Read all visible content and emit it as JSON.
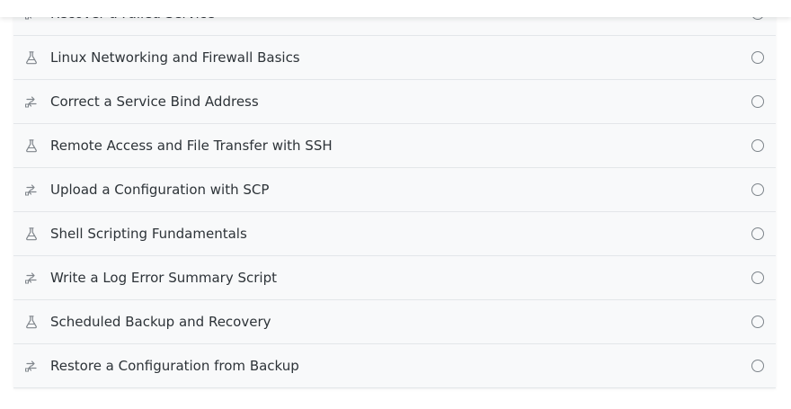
{
  "items": [
    {
      "label": "Recover a Failed Service",
      "icon": "lab-swap-icon"
    },
    {
      "label": "Linux Networking and Firewall Basics",
      "icon": "flask-icon"
    },
    {
      "label": "Correct a Service Bind Address",
      "icon": "lab-swap-icon"
    },
    {
      "label": "Remote Access and File Transfer with SSH",
      "icon": "flask-icon"
    },
    {
      "label": "Upload a Configuration with SCP",
      "icon": "lab-swap-icon"
    },
    {
      "label": "Shell Scripting Fundamentals",
      "icon": "flask-icon"
    },
    {
      "label": "Write a Log Error Summary Script",
      "icon": "lab-swap-icon"
    },
    {
      "label": "Scheduled Backup and Recovery",
      "icon": "flask-icon"
    },
    {
      "label": "Restore a Configuration from Backup",
      "icon": "lab-swap-icon"
    }
  ],
  "colors": {
    "row_background": "#f8f9fa",
    "divider": "#e3e6e9",
    "text": "#2d3338",
    "icon": "#80868c"
  }
}
